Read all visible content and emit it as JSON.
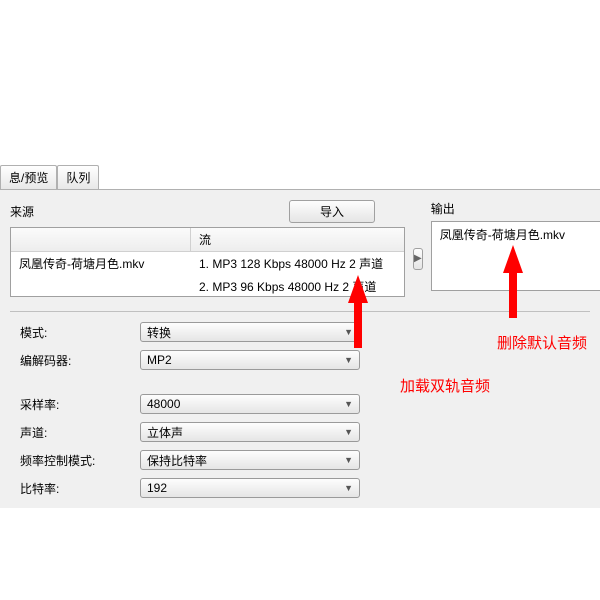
{
  "tabs": {
    "preview": "息/预览",
    "queue": "队列"
  },
  "source": {
    "title": "来源",
    "import_label": "导入",
    "col_stream": "流",
    "filename": "凤凰传奇-荷塘月色.mkv",
    "streams": [
      "1. MP3 128 Kbps 48000 Hz 2 声道",
      "2. MP3 96 Kbps 48000 Hz 2 声道"
    ]
  },
  "output": {
    "title": "输出",
    "filename": "凤凰传奇-荷塘月色.mkv"
  },
  "form": {
    "mode_label": "模式:",
    "mode_value": "转换",
    "codec_label": "编解码器:",
    "codec_value": "MP2",
    "samplerate_label": "采样率:",
    "samplerate_value": "48000",
    "channel_label": "声道:",
    "channel_value": "立体声",
    "ratemode_label": "频率控制模式:",
    "ratemode_value": "保持比特率",
    "bitrate_label": "比特率:",
    "bitrate_value": "192"
  },
  "annotations": {
    "load_dual": "加载双轨音频",
    "delete_default": "删除默认音频"
  }
}
